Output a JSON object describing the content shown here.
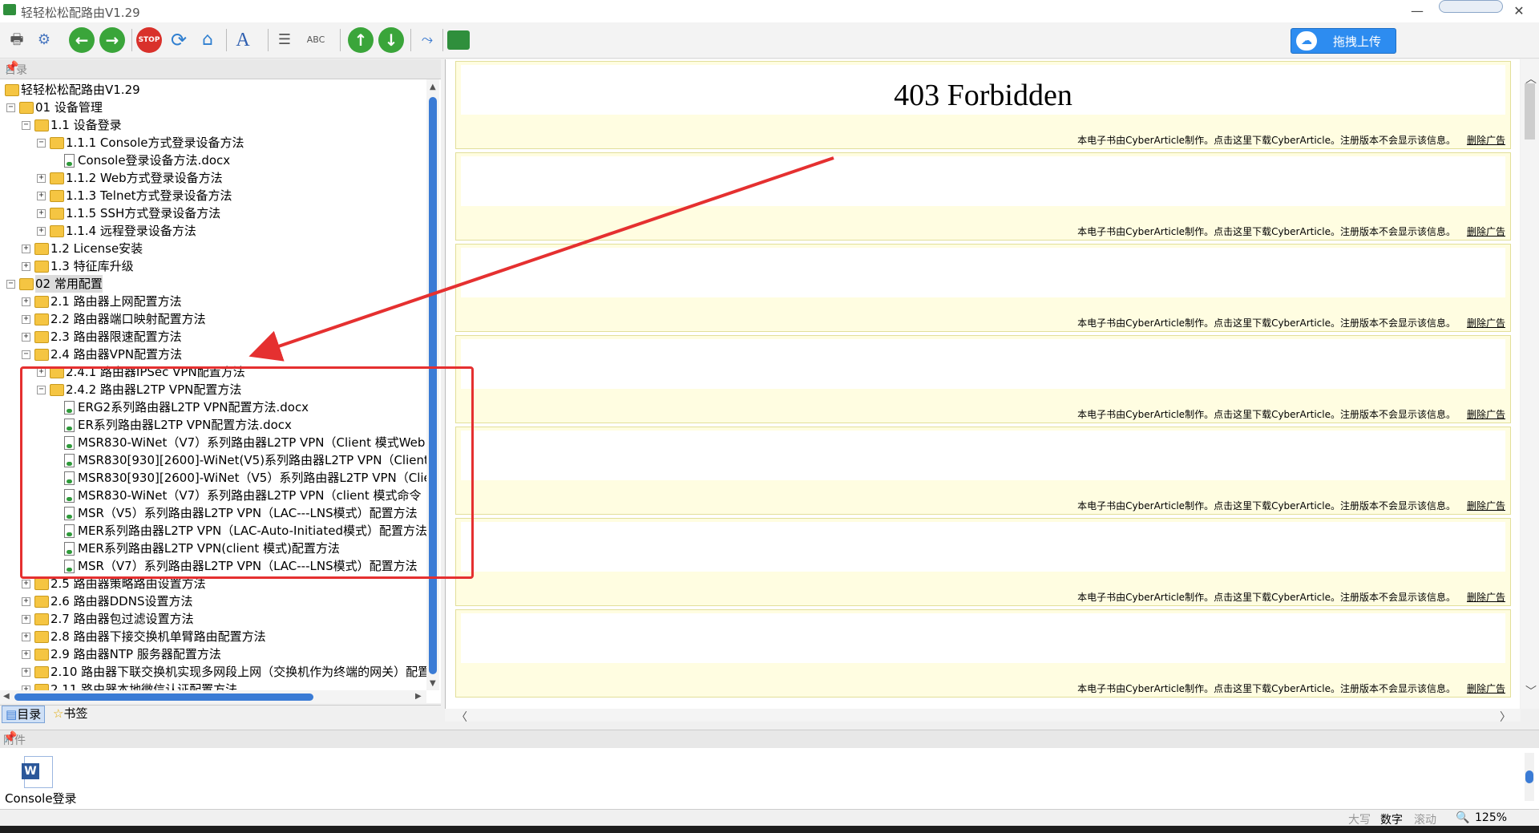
{
  "window": {
    "title": "轻轻松松配路由V1.29"
  },
  "toolbar": {
    "upload_label": "拖拽上传",
    "buttons": [
      "print-icon",
      "settings-icon",
      "back-icon",
      "forward-icon",
      "stop-icon",
      "refresh-icon",
      "home-icon",
      "font-icon",
      "list-icon",
      "spellcheck-icon",
      "up-icon",
      "down-icon",
      "link-icon",
      "book-icon"
    ],
    "stop_text": "STOP",
    "abc_text": "ABC"
  },
  "tree": {
    "header": "目录",
    "rows": [
      {
        "level": 0,
        "kind": "folder",
        "exp": "",
        "label": "轻轻松松配路由V1.29"
      },
      {
        "level": 0,
        "kind": "folder",
        "exp": "−",
        "label": "01 设备管理"
      },
      {
        "level": 1,
        "kind": "folder",
        "exp": "−",
        "label": "1.1 设备登录"
      },
      {
        "level": 2,
        "kind": "folder",
        "exp": "−",
        "label": "1.1.1 Console方式登录设备方法"
      },
      {
        "level": 3,
        "kind": "doc",
        "exp": "",
        "label": "Console登录设备方法.docx"
      },
      {
        "level": 2,
        "kind": "folder",
        "exp": "+",
        "label": "1.1.2 Web方式登录设备方法"
      },
      {
        "level": 2,
        "kind": "folder",
        "exp": "+",
        "label": "1.1.3 Telnet方式登录设备方法"
      },
      {
        "level": 2,
        "kind": "folder",
        "exp": "+",
        "label": "1.1.5 SSH方式登录设备方法"
      },
      {
        "level": 2,
        "kind": "folder",
        "exp": "+",
        "label": "1.1.4 远程登录设备方法"
      },
      {
        "level": 1,
        "kind": "folder",
        "exp": "+",
        "label": "1.2 License安装"
      },
      {
        "level": 1,
        "kind": "folder",
        "exp": "+",
        "label": "1.3 特征库升级"
      },
      {
        "level": 0,
        "kind": "folder",
        "exp": "−",
        "label": "02 常用配置",
        "selected": true
      },
      {
        "level": 1,
        "kind": "folder",
        "exp": "+",
        "label": "2.1 路由器上网配置方法"
      },
      {
        "level": 1,
        "kind": "folder",
        "exp": "+",
        "label": "2.2 路由器端口映射配置方法"
      },
      {
        "level": 1,
        "kind": "folder",
        "exp": "+",
        "label": "2.3 路由器限速配置方法"
      },
      {
        "level": 1,
        "kind": "folder",
        "exp": "−",
        "label": "2.4 路由器VPN配置方法"
      },
      {
        "level": 2,
        "kind": "folder",
        "exp": "+",
        "label": "2.4.1 路由器IPSec VPN配置方法"
      },
      {
        "level": 2,
        "kind": "folder",
        "exp": "−",
        "label": "2.4.2 路由器L2TP VPN配置方法"
      },
      {
        "level": 3,
        "kind": "doc",
        "exp": "",
        "label": "ERG2系列路由器L2TP VPN配置方法.docx"
      },
      {
        "level": 3,
        "kind": "doc",
        "exp": "",
        "label": "ER系列路由器L2TP VPN配置方法.docx"
      },
      {
        "level": 3,
        "kind": "doc",
        "exp": "",
        "label": "MSR830-WiNet（V7）系列路由器L2TP VPN（Client 模式Web"
      },
      {
        "level": 3,
        "kind": "doc",
        "exp": "",
        "label": "MSR830[930][2600]-WiNet(V5)系列路由器L2TP VPN（Client"
      },
      {
        "level": 3,
        "kind": "doc",
        "exp": "",
        "label": "MSR830[930][2600]-WiNet（V5）系列路由器L2TP VPN（Clie"
      },
      {
        "level": 3,
        "kind": "doc",
        "exp": "",
        "label": "MSR830-WiNet（V7）系列路由器L2TP VPN（client 模式命令"
      },
      {
        "level": 3,
        "kind": "doc",
        "exp": "",
        "label": "MSR（V5）系列路由器L2TP VPN（LAC---LNS模式）配置方法"
      },
      {
        "level": 3,
        "kind": "doc",
        "exp": "",
        "label": "MER系列路由器L2TP VPN（LAC-Auto-Initiated模式）配置方法"
      },
      {
        "level": 3,
        "kind": "doc",
        "exp": "",
        "label": "MER系列路由器L2TP VPN(client 模式)配置方法"
      },
      {
        "level": 3,
        "kind": "doc",
        "exp": "",
        "label": "MSR（V7）系列路由器L2TP VPN（LAC---LNS模式）配置方法"
      },
      {
        "level": 1,
        "kind": "folder",
        "exp": "+",
        "label": "2.5 路由器策略路由设置方法"
      },
      {
        "level": 1,
        "kind": "folder",
        "exp": "+",
        "label": "2.6 路由器DDNS设置方法"
      },
      {
        "level": 1,
        "kind": "folder",
        "exp": "+",
        "label": "2.7 路由器包过滤设置方法"
      },
      {
        "level": 1,
        "kind": "folder",
        "exp": "+",
        "label": "2.8 路由器下接交换机单臂路由配置方法"
      },
      {
        "level": 1,
        "kind": "folder",
        "exp": "+",
        "label": "2.9 路由器NTP 服务器配置方法"
      },
      {
        "level": 1,
        "kind": "folder",
        "exp": "+",
        "label": "2.10 路由器下联交换机实现多网段上网（交换机作为终端的网关）配置"
      },
      {
        "level": 1,
        "kind": "folder",
        "exp": "+",
        "label": "2.11 路由器本地微信认证配置方法"
      }
    ]
  },
  "tabs": [
    {
      "label": "目录",
      "active": true
    },
    {
      "label": "书签",
      "active": false
    }
  ],
  "document": {
    "heading": "403 Forbidden",
    "notice": "本电子书由CyberArticle制作。点击这里下载CyberArticle。注册版本不会显示该信息。",
    "remove_ad": "删除广告",
    "page_count": 7
  },
  "attachments": {
    "header": "附件",
    "items": [
      {
        "label": "Console登录",
        "icon": "word-doc-icon",
        "icon_letter": "W"
      }
    ]
  },
  "status": {
    "caps": "大写",
    "num": "数字",
    "scroll": "滚动",
    "zoom": "125%"
  },
  "colors": {
    "annotation": "#e53030",
    "accent": "#3a7bd5",
    "page_bg": "#fffde1"
  }
}
